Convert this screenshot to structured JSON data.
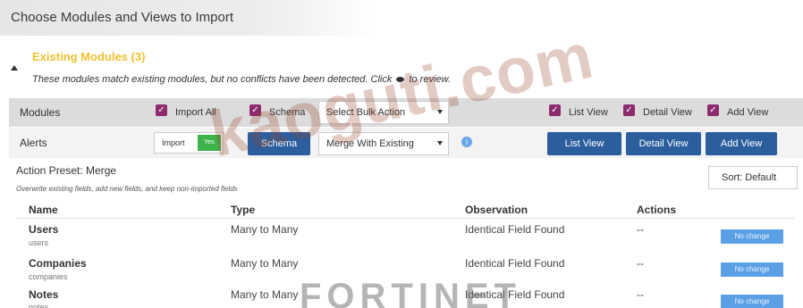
{
  "header": {
    "title": "Choose Modules and Views to Import"
  },
  "existing": {
    "heading": "Existing Modules (3)",
    "description_before": "These modules match existing modules, but no conflicts have been detected. Click",
    "description_after": "to review."
  },
  "modules_row": {
    "label": "Modules",
    "import_all_label": "Import All",
    "schema_label": "Schema",
    "bulk_action": "Select Bulk Action",
    "list_view_label": "List View",
    "detail_view_label": "Detail View",
    "add_view_label": "Add View"
  },
  "alerts_row": {
    "label": "Alerts",
    "import_label": "Import",
    "toggle_label": "Yes",
    "schema_button": "Schema",
    "merge_select": "Merge With Existing",
    "list_view_button": "List View",
    "detail_view_button": "Detail View",
    "add_view_button": "Add View"
  },
  "preset": {
    "title": "Action Preset: Merge",
    "description": "Overwrite existing fields, add new fields, and keep non-imported fields",
    "sort": "Sort: Default"
  },
  "table": {
    "headers": [
      "Name",
      "Type",
      "Observation",
      "Actions"
    ],
    "rows": [
      {
        "name": "Users",
        "sub": "users",
        "type": "Many to Many",
        "observation": "Identical Field Found",
        "actions": "--",
        "badge": "No change"
      },
      {
        "name": "Companies",
        "sub": "companies",
        "type": "Many to Many",
        "observation": "Identical Field Found",
        "actions": "--",
        "badge": "No change"
      },
      {
        "name": "Notes",
        "sub": "notes",
        "type": "Many to Many",
        "observation": "Identical Field Found",
        "actions": "--",
        "badge": "No change"
      }
    ]
  },
  "overlay": {
    "watermark": "kaoguti.com",
    "logo": "FORTINET"
  },
  "colors": {
    "accent_blue": "#2c5e9e",
    "checkbox_purple": "#8c2b6e",
    "toggle_green": "#3cb44b",
    "heading_yellow": "#f0c030",
    "badge_blue": "#5ba0e6"
  }
}
